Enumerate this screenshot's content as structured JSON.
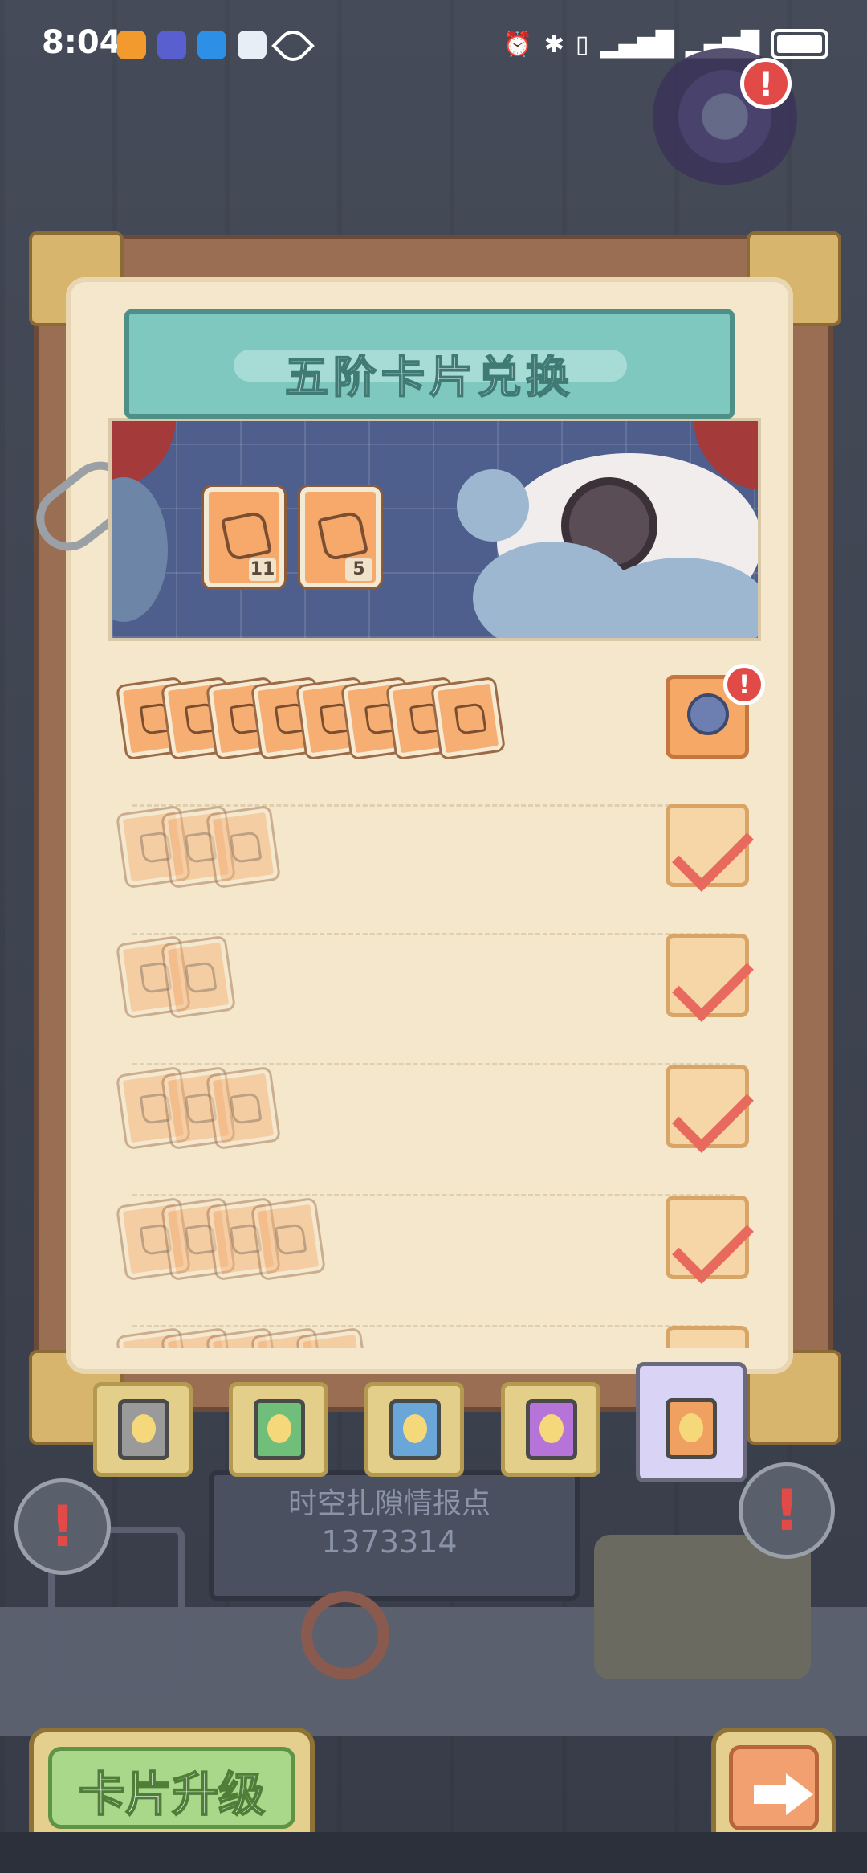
{
  "status_bar": {
    "time": "8:04",
    "notification_icons": [
      "app-orange-icon",
      "app-tie-icon",
      "app-message-icon",
      "app-chat-icon",
      "eye-icon"
    ],
    "system_icons": [
      "alarm-icon",
      "bluetooth-icon",
      "vibrate-icon",
      "signal-icon",
      "signal-icon",
      "battery-icon"
    ]
  },
  "panel": {
    "title": "五阶卡片兑换",
    "scene_cards": [
      {
        "count": "11"
      },
      {
        "count": "5"
      }
    ],
    "rows": [
      {
        "cards": 8,
        "state": "claimable",
        "reward_icon": "planet-orb-icon",
        "alert": "!"
      },
      {
        "cards": 3,
        "state": "claimed",
        "reward_icon": "scroll-icon"
      },
      {
        "cards": 2,
        "state": "claimed",
        "reward_icon": "book-icon"
      },
      {
        "cards": 3,
        "state": "claimed",
        "reward_icon": "helmet-icon"
      },
      {
        "cards": 4,
        "state": "claimed",
        "reward_icon": "potion-icon"
      },
      {
        "cards": 5,
        "state": "partial",
        "reward_icon": "chest-icon"
      }
    ]
  },
  "tier_tabs": [
    {
      "name": "tier-1",
      "color": "#9a9a9a"
    },
    {
      "name": "tier-2",
      "color": "#6fbf7a"
    },
    {
      "name": "tier-3",
      "color": "#6aa7d8"
    },
    {
      "name": "tier-4",
      "color": "#b774d8"
    },
    {
      "name": "tier-5",
      "color": "#f0a060",
      "active": true
    }
  ],
  "background": {
    "board_name": "时空扎隙情报点",
    "board_id": "1373314",
    "alert": "!"
  },
  "buttons": {
    "upgrade_label": "卡片升级",
    "next_icon": "arrow-right-icon"
  },
  "colors": {
    "banner": "#7ec8c0",
    "paper": "#f4e7cc",
    "check": "#e86a5e",
    "upgrade_button": "#a9d88a",
    "next_button": "#f2a070",
    "alert": "#e24a48"
  }
}
